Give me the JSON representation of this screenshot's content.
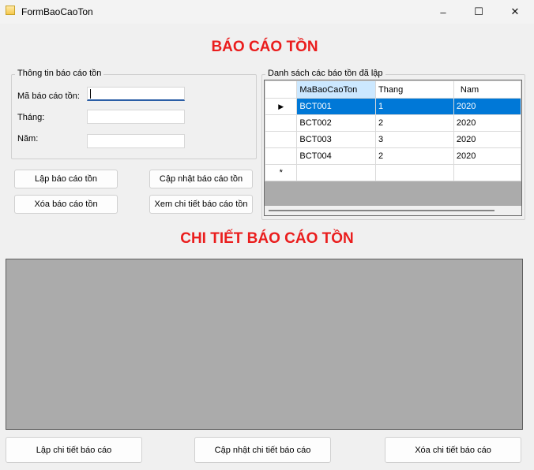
{
  "window": {
    "title": "FormBaoCaoTon",
    "controls": {
      "minimize": "–",
      "maximize": "☐",
      "close": "✕"
    }
  },
  "header": {
    "title": "BÁO CÁO TỒN"
  },
  "info_group": {
    "label": "Thông tin báo cáo tồn",
    "fields": [
      {
        "label": "Mã báo cáo tồn:",
        "value": ""
      },
      {
        "label": "Tháng:",
        "value": ""
      },
      {
        "label": "Năm:",
        "value": ""
      }
    ]
  },
  "buttons": {
    "add_report": "Lập báo cáo tồn",
    "update_report": "Cập nhật báo cáo tồn",
    "delete_report": "Xóa báo cáo tồn",
    "view_detail": "Xem chi tiết báo cáo tồn"
  },
  "list_group": {
    "label": "Danh sách các báo tồn đã lập",
    "columns": [
      "MaBaoCaoTon",
      "Thang",
      "Nam"
    ],
    "rows": [
      [
        "BCT001",
        "1",
        "2020"
      ],
      [
        "BCT002",
        "2",
        "2020"
      ],
      [
        "BCT003",
        "3",
        "2020"
      ],
      [
        "BCT004",
        "2",
        "2020"
      ]
    ],
    "selected_row": 0,
    "new_row_marker": "*",
    "current_row_marker": "▶"
  },
  "detail_section": {
    "title": "CHI TIẾT BÁO CÁO TỒN"
  },
  "detail_buttons": {
    "add_detail": "Lập chi tiết báo cáo",
    "update_detail": "Cập nhật chi tiết báo cáo",
    "delete_detail": "Xóa chi tiết báo cáo"
  },
  "colors": {
    "title_red": "#ea1d1d",
    "grid_background": "#ababab",
    "selection_blue": "#0078d7",
    "header_highlight": "#cce8ff"
  }
}
